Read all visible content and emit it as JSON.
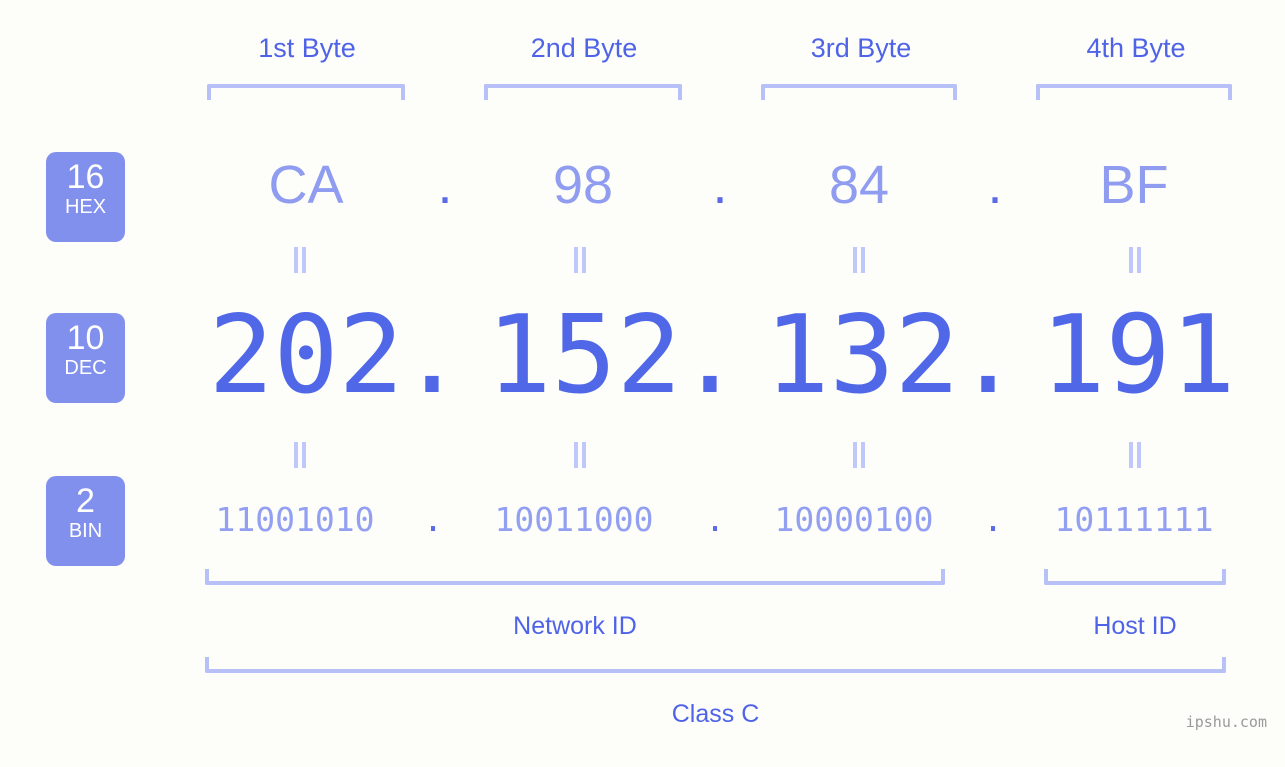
{
  "header": {
    "byte_labels": [
      "1st Byte",
      "2nd Byte",
      "3rd Byte",
      "4th Byte"
    ]
  },
  "badges": [
    {
      "number": "16",
      "unit": "HEX"
    },
    {
      "number": "10",
      "unit": "DEC"
    },
    {
      "number": "2",
      "unit": "BIN"
    }
  ],
  "rows": {
    "hex": {
      "values": [
        "CA",
        "98",
        "84",
        "BF"
      ],
      "separator": "."
    },
    "dec": {
      "values": [
        "202",
        "152",
        "132",
        "191"
      ],
      "separator": "."
    },
    "bin": {
      "values": [
        "11001010",
        "10011000",
        "10000100",
        "10111111"
      ],
      "separator": "."
    }
  },
  "equals_symbol": "=",
  "sections": {
    "network_id": "Network ID",
    "host_id": "Host ID",
    "class": "Class C"
  },
  "watermark": "ipshu.com",
  "colors": {
    "background": "#fdfdfa",
    "badge_bg": "#8290ed",
    "accent_strong": "#4f63e8",
    "accent_dec": "#5068e8",
    "accent_light": "#8f9cf0",
    "bracket": "#b8c0f8",
    "equals": "#c0c7fa",
    "watermark": "#9a9a9a"
  }
}
